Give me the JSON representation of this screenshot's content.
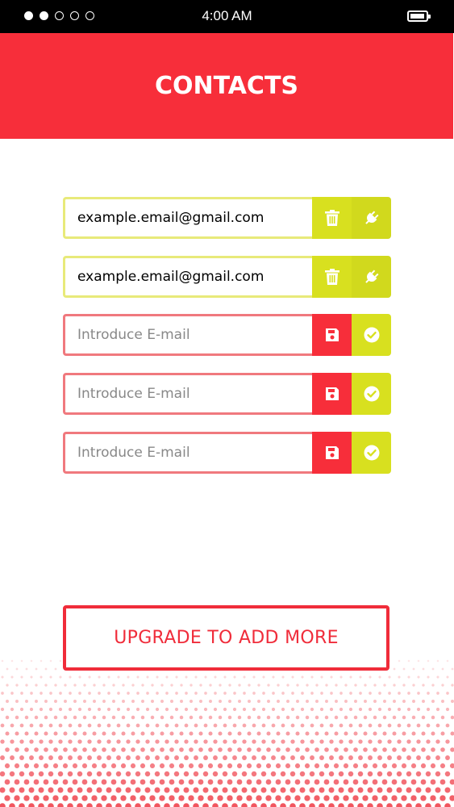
{
  "status_bar": {
    "time": "4:00 AM",
    "signal_dots": [
      true,
      true,
      false,
      false,
      false
    ]
  },
  "header": {
    "title": "CONTACTS"
  },
  "contacts": [
    {
      "state": "saved",
      "value": "example.email@gmail.com",
      "placeholder": "Introduce E-mail",
      "actions": [
        "trash-icon",
        "plug-icon"
      ]
    },
    {
      "state": "saved",
      "value": "example.email@gmail.com",
      "placeholder": "Introduce E-mail",
      "actions": [
        "trash-icon",
        "plug-icon"
      ]
    },
    {
      "state": "empty",
      "value": "",
      "placeholder": "Introduce E-mail",
      "actions": [
        "save-icon",
        "check-circle-icon"
      ]
    },
    {
      "state": "empty",
      "value": "",
      "placeholder": "Introduce E-mail",
      "actions": [
        "save-icon",
        "check-circle-icon"
      ]
    },
    {
      "state": "empty",
      "value": "",
      "placeholder": "Introduce E-mail",
      "actions": [
        "save-icon",
        "check-circle-icon"
      ]
    }
  ],
  "upgrade_button": {
    "label": "UPGRADE TO ADD MORE"
  },
  "colors": {
    "primary_red": "#f72e3a",
    "lime": "#d8e01f",
    "lime_border": "#e8ea7a",
    "red_border": "#f0797e",
    "status_bar": "#000000"
  }
}
